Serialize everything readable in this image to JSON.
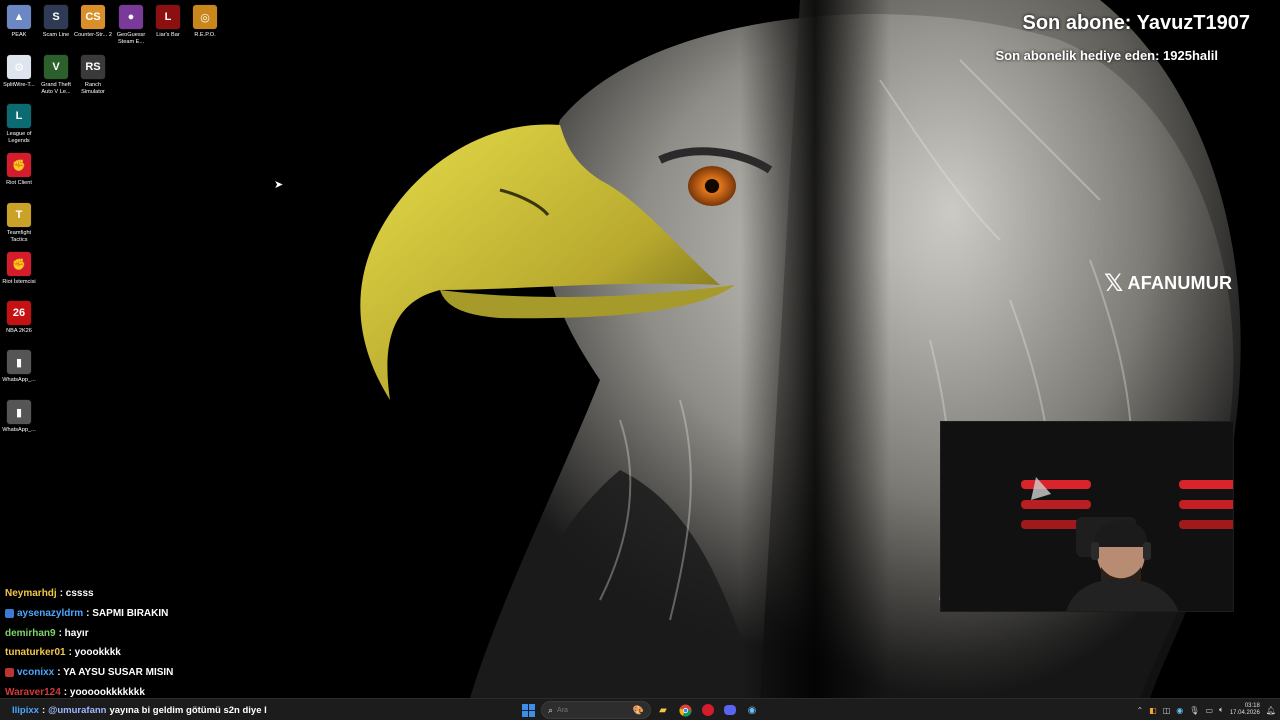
{
  "desktop_icons": [
    {
      "name": "peak",
      "label": "PEAK",
      "color": "#6b88c5",
      "glyph": "▲"
    },
    {
      "name": "scam-line",
      "label": "Scam Line",
      "color": "#2f3b55",
      "glyph": "S"
    },
    {
      "name": "counter-strike",
      "label": "Counter-Str... 2",
      "color": "#d9902a",
      "glyph": "CS"
    },
    {
      "name": "geoguessr",
      "label": "GeoGuessr Steam E...",
      "color": "#7a3a9a",
      "glyph": "●"
    },
    {
      "name": "liars-bar",
      "label": "Liar's Bar",
      "color": "#8c1010",
      "glyph": "L"
    },
    {
      "name": "repo",
      "label": "R.E.P.O.",
      "color": "#c8861b",
      "glyph": "◎"
    },
    {
      "name": "splitwire",
      "label": "SplitWire-T...",
      "color": "#dfe5ee",
      "glyph": "⚙"
    },
    {
      "name": "gta-v",
      "label": "Grand Theft Auto V Le...",
      "color": "#2b5f2b",
      "glyph": "V"
    },
    {
      "name": "ranch-simulator",
      "label": "Ranch Simulator",
      "color": "#3a3a3a",
      "glyph": "RS"
    },
    {
      "name": "league-of-legends",
      "label": "League of Legends",
      "color": "#0b6b73",
      "glyph": "L"
    },
    {
      "name": "riot-client",
      "label": "Riot Client",
      "color": "#d41c2c",
      "glyph": "✊"
    },
    {
      "name": "teamfight-tactics",
      "label": "Teamfight Tactics",
      "color": "#c9a227",
      "glyph": "T"
    },
    {
      "name": "riot-istemcisi",
      "label": "Riot İstemcisi",
      "color": "#d41c2c",
      "glyph": "✊"
    },
    {
      "name": "nba-2k26",
      "label": "NBA 2K26",
      "color": "#c51111",
      "glyph": "26"
    },
    {
      "name": "whatsapp-1",
      "label": "WhatsApp_...",
      "color": "#555555",
      "glyph": "▮"
    },
    {
      "name": "whatsapp-2",
      "label": "WhatsApp_...",
      "color": "#555555",
      "glyph": "▮"
    }
  ],
  "overlay": {
    "last_sub": "Son abone: YavuzT1907",
    "gift_sub": "Son abonelik hediye eden: 1925halil",
    "social_handle": "AFANUMUR",
    "social_glyph": "𝕏"
  },
  "chat": [
    {
      "user": "Neymarhdj",
      "color": "#f0c94a",
      "badge": "",
      "msg": ": cssss"
    },
    {
      "user": "aysenazyldrm",
      "color": "#4aa8ff",
      "badge": "#3a7bd5",
      "msg": ": SAPMI BIRAKIN"
    },
    {
      "user": "demirhan9",
      "color": "#7fd36b",
      "badge": "",
      "msg": ": hayır"
    },
    {
      "user": "tunaturker01",
      "color": "#f0c94a",
      "badge": "",
      "msg": ": yoookkkk"
    },
    {
      "user": "vconixx",
      "color": "#4aa8ff",
      "badge": "#b33",
      "msg": ": YA AYSU SUSAR MISIN"
    },
    {
      "user": "Waraver124",
      "color": "#d33a3a",
      "badge": "",
      "msg": ": yoooookkkkkkk"
    }
  ],
  "chat_input": {
    "user": "llipixx",
    "mention": "@umurafann",
    "msg": "yayına bi geldim götümü s2n diye l"
  },
  "taskbar": {
    "search_placeholder": "Ara",
    "clock_time": "03:18",
    "clock_date": "17.04.2026"
  },
  "colors": {
    "taskbar_bg": "#1c1c1c",
    "start_blue": "#3b8eea"
  }
}
